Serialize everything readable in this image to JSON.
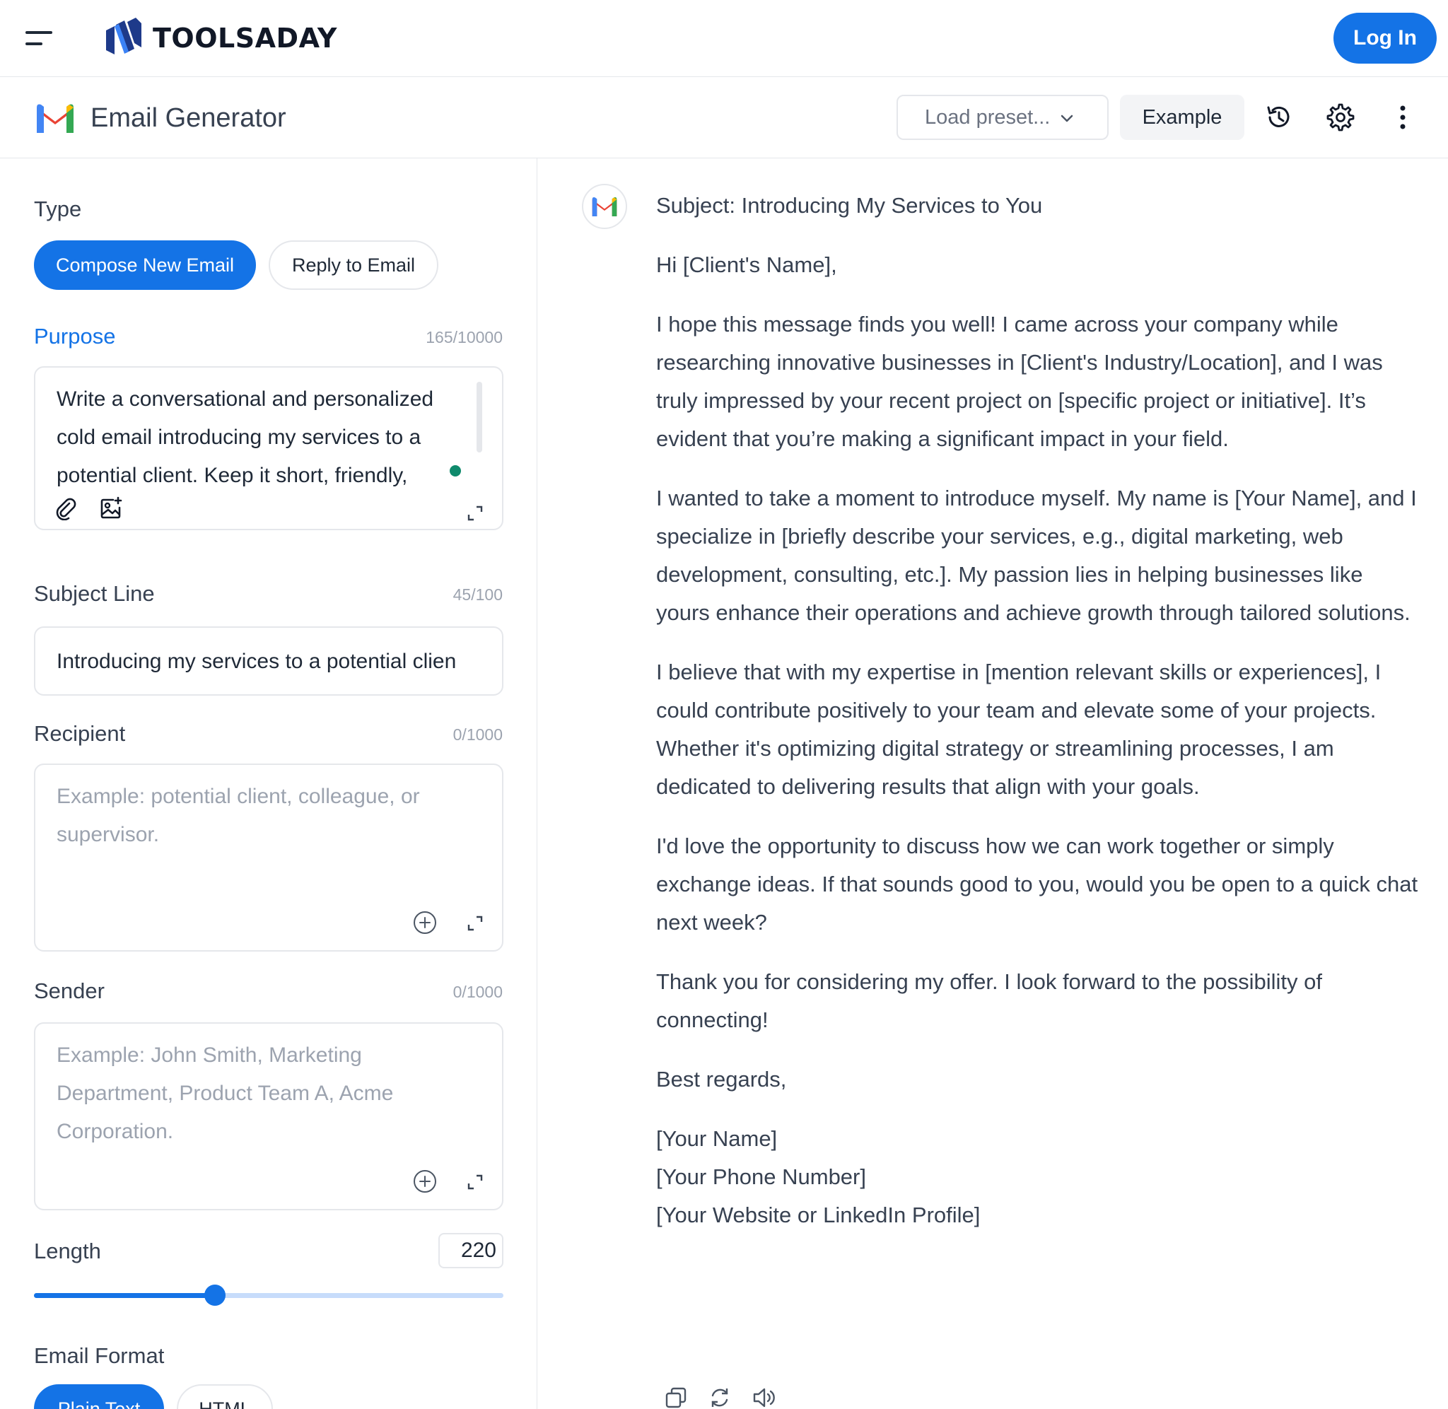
{
  "nav": {
    "brand": "TOOLSADAY",
    "login_label": "Log In",
    "accent": "#1473e6"
  },
  "tool": {
    "title": "Email Generator",
    "preset_placeholder": "Load preset...",
    "example_label": "Example",
    "icons": [
      "history-icon",
      "gear-icon",
      "more-vertical-icon"
    ]
  },
  "form": {
    "type": {
      "label": "Type",
      "options": [
        "Compose New Email",
        "Reply to Email"
      ],
      "selected": "Compose New Email"
    },
    "purpose": {
      "label": "Purpose",
      "counter": "165/10000",
      "value": "Write a conversational and personalized cold email introducing my services to a potential client. Keep it short, friendly,"
    },
    "subject": {
      "label": "Subject Line",
      "counter": "45/100",
      "value": "Introducing my services to a potential clien"
    },
    "recipient": {
      "label": "Recipient",
      "counter": "0/1000",
      "placeholder": "Example: potential client, colleague, or supervisor."
    },
    "sender": {
      "label": "Sender",
      "counter": "0/1000",
      "placeholder": "Example: John Smith, Marketing Department, Product Team A, Acme Corporation."
    },
    "length": {
      "label": "Length",
      "value": "220",
      "slider_fraction": 0.385
    },
    "format": {
      "label": "Email Format",
      "options": [
        "Plain Text",
        "HTML"
      ],
      "selected": "Plain Text"
    }
  },
  "output": {
    "subject": "Subject: Introducing My Services to You",
    "greeting": "Hi [Client's Name],",
    "paragraphs": [
      "I hope this message finds you well! I came across your company while researching innovative businesses in [Client's Industry/Location], and I was truly impressed by your recent project on [specific project or initiative]. It’s evident that you’re making a significant impact in your field.",
      "I wanted to take a moment to introduce myself. My name is [Your Name], and I specialize in [briefly describe your services, e.g., digital marketing, web development, consulting, etc.]. My passion lies in helping businesses like yours enhance their operations and achieve growth through tailored solutions.",
      "I believe that with my expertise in [mention relevant skills or experiences], I could contribute positively to your team and elevate some of your projects. Whether it's optimizing digital strategy or streamlining processes, I am dedicated to delivering results that align with your goals.",
      "I'd love the opportunity to discuss how we can work together or simply exchange ideas. If that sounds good to you, would you be open to a quick chat next week?",
      "Thank you for considering my offer. I look forward to the possibility of connecting!"
    ],
    "closing": "Best regards,",
    "signature": [
      "[Your Name]",
      "[Your Phone Number]",
      "[Your Website or LinkedIn Profile]"
    ],
    "action_icons": [
      "copy-icon",
      "regenerate-icon",
      "speaker-icon"
    ]
  }
}
